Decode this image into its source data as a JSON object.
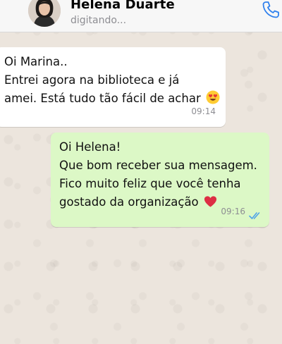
{
  "header": {
    "contact_name": "Helena Duarte",
    "status": "digitando...",
    "call_icon": "phone-icon"
  },
  "messages": [
    {
      "direction": "incoming",
      "lines": [
        "Oi Marina..",
        "Entrei agora na biblioteca e já",
        "amei. Está tudo tão fácil de achar"
      ],
      "emoji": "heart-eyes-emoji",
      "time": "09:14"
    },
    {
      "direction": "outgoing",
      "lines": [
        "Oi Helena!",
        "Que bom receber sua mensagem.",
        "Fico muito feliz que você tenha",
        "gostado da organização"
      ],
      "emoji": "red-heart-emoji",
      "time": "09:16",
      "status_icon": "double-check-read-icon"
    }
  ],
  "colors": {
    "chat_background": "#ECE5DD",
    "incoming_bubble": "#FFFFFF",
    "outgoing_bubble": "#DCF8C6",
    "accent": "#2F80ED",
    "read_ticks": "#4FA3E8"
  }
}
